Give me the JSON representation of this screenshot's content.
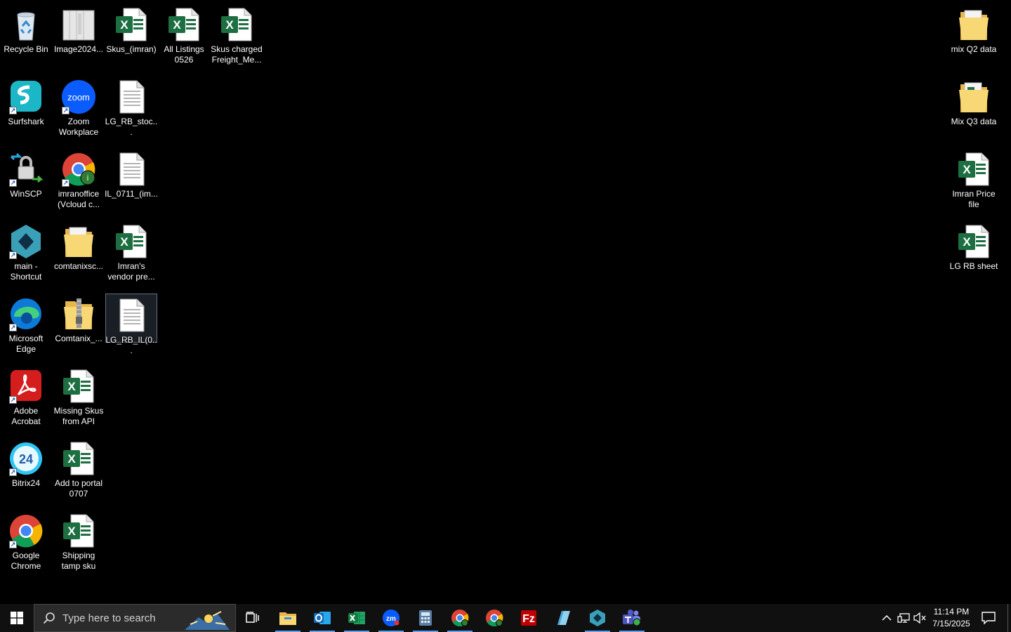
{
  "desktop": {
    "icons": [
      {
        "label": "Recycle Bin",
        "icon": "recycle-bin-icon"
      },
      {
        "label": "Image2024...",
        "icon": "archive-file-icon"
      },
      {
        "label": "Skus_(imran)",
        "icon": "excel-file-icon"
      },
      {
        "label": "All Listings 0526",
        "icon": "excel-file-icon"
      },
      {
        "label": "Skus charged Freight_Me...",
        "icon": "excel-file-icon"
      },
      {
        "label": "Surfshark",
        "icon": "surfshark-icon"
      },
      {
        "label": "Zoom Workplace",
        "icon": "zoom-icon"
      },
      {
        "label": "LG_RB_stoc...",
        "icon": "text-file-icon"
      },
      {
        "label": "WinSCP",
        "icon": "winscp-icon"
      },
      {
        "label": "imranoffice (Vcloud c...",
        "icon": "chrome-profile-icon"
      },
      {
        "label": "IL_0711_(im...",
        "icon": "text-file-icon"
      },
      {
        "label": "main - Shortcut",
        "icon": "app-shortcut-icon"
      },
      {
        "label": "comtanixsc...",
        "icon": "folder-icon"
      },
      {
        "label": "Imran's vendor pre...",
        "icon": "excel-file-icon"
      },
      {
        "label": "Microsoft Edge",
        "icon": "edge-icon"
      },
      {
        "label": "Comtanix_...",
        "icon": "zip-folder-icon"
      },
      {
        "label": "LG_RB_IL(0...",
        "icon": "text-file-icon"
      },
      {
        "label": "Adobe Acrobat",
        "icon": "acrobat-icon"
      },
      {
        "label": "Missing Skus from API",
        "icon": "excel-file-icon"
      },
      {
        "label": "Bitrix24",
        "icon": "bitrix24-icon"
      },
      {
        "label": "Add to portal 0707",
        "icon": "excel-file-icon"
      },
      {
        "label": "Google Chrome",
        "icon": "chrome-icon"
      },
      {
        "label": "Shipping tamp sku",
        "icon": "excel-file-icon"
      },
      {
        "label": "mix Q2 data",
        "icon": "folder-icon"
      },
      {
        "label": "Mix Q3 data",
        "icon": "folder-icon"
      },
      {
        "label": "Imran Price file",
        "icon": "excel-file-icon"
      },
      {
        "label": "LG RB sheet",
        "icon": "excel-file-icon"
      }
    ]
  },
  "taskbar": {
    "search_placeholder": "Type here to search",
    "pinned": [
      "file-explorer",
      "outlook",
      "excel",
      "zoom",
      "calculator",
      "chrome",
      "chrome-profile",
      "filezilla",
      "notepad",
      "app-shortcut",
      "teams"
    ],
    "clock": {
      "time": "11:14 PM",
      "date": "7/15/2025"
    }
  },
  "colors": {
    "taskbar": "#101010",
    "running_indicator": "#5ea0ef",
    "excel_green": "#1d6f42"
  }
}
